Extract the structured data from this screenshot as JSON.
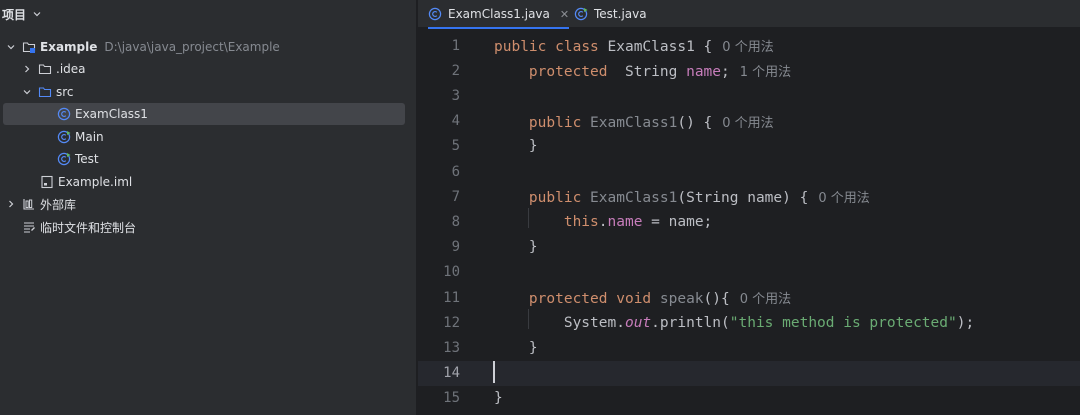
{
  "project_panel": {
    "title": "项目",
    "tree": [
      {
        "label": "Example",
        "path": "D:\\java\\java_project\\Example",
        "icon": "module-folder-icon",
        "expanded": true
      },
      {
        "label": ".idea",
        "icon": "folder-icon",
        "expanded": false
      },
      {
        "label": "src",
        "icon": "source-folder-icon",
        "expanded": true
      },
      {
        "label": "ExamClass1",
        "icon": "java-class-icon",
        "selected": true
      },
      {
        "label": "Main",
        "icon": "java-class-runnable-icon"
      },
      {
        "label": "Test",
        "icon": "java-class-runnable-icon"
      },
      {
        "label": "Example.iml",
        "icon": "iml-file-icon"
      },
      {
        "label": "外部库",
        "icon": "library-icon",
        "expanded": false
      },
      {
        "label": "临时文件和控制台",
        "icon": "scratches-icon"
      }
    ]
  },
  "editor": {
    "tabs": [
      {
        "label": "ExamClass1.java",
        "icon": "java-class-icon",
        "active": true,
        "close": "✕"
      },
      {
        "label": "Test.java",
        "icon": "java-class-runnable-icon",
        "active": false
      }
    ],
    "current_line": 14,
    "lines": [
      {
        "n": "1",
        "hint": "0 个用法"
      },
      {
        "n": "2",
        "hint": "1 个用法"
      },
      {
        "n": "3"
      },
      {
        "n": "4",
        "hint": "0 个用法"
      },
      {
        "n": "5"
      },
      {
        "n": "6"
      },
      {
        "n": "7",
        "hint": "0 个用法"
      },
      {
        "n": "8"
      },
      {
        "n": "9"
      },
      {
        "n": "10"
      },
      {
        "n": "11",
        "hint": "0 个用法"
      },
      {
        "n": "12"
      },
      {
        "n": "13"
      },
      {
        "n": "14"
      },
      {
        "n": "15"
      }
    ],
    "tokens": {
      "public": "public",
      "class": "class",
      "protected": "protected",
      "void": "void",
      "this": "this",
      "String": "String",
      "name": "name",
      "ExamClass1": "ExamClass1",
      "speak": "speak",
      "System": "System",
      "out": "out",
      "println": "println",
      "message": "\"this method is protected\""
    }
  },
  "colors": {
    "panel_bg": "#2b2d30",
    "editor_bg": "#1e1f22",
    "keyword": "#cf8e6d",
    "field": "#c77dbb",
    "string": "#6aab73",
    "accent": "#3574f0"
  }
}
